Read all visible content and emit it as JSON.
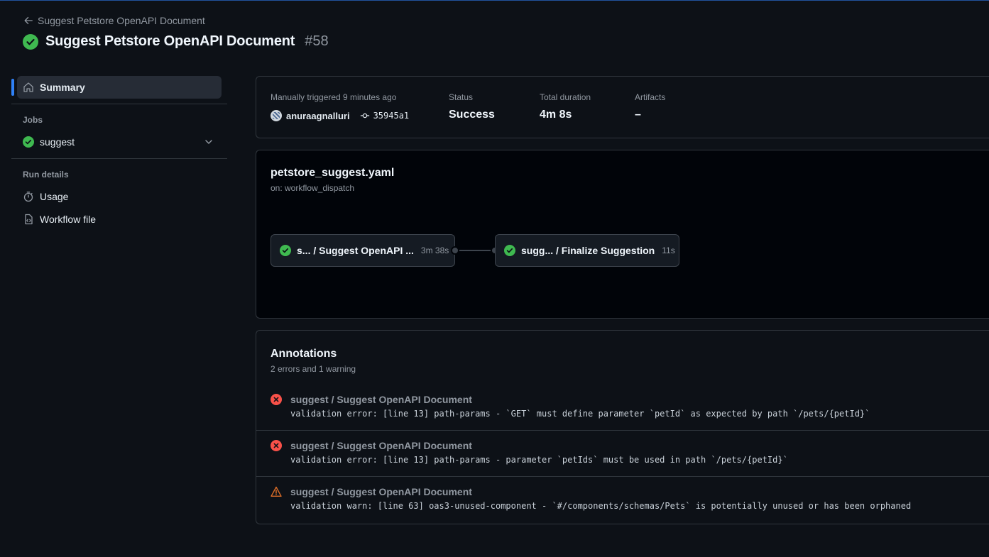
{
  "header": {
    "back_label": "Suggest Petstore OpenAPI Document",
    "title": "Suggest Petstore OpenAPI Document",
    "run_number": "#58"
  },
  "sidebar": {
    "summary_label": "Summary",
    "jobs_heading": "Jobs",
    "job_label": "suggest",
    "run_details_heading": "Run details",
    "usage_label": "Usage",
    "workflow_file_label": "Workflow file"
  },
  "summary": {
    "trigger_label": "Manually triggered 9 minutes ago",
    "actor": "anuraagnalluri",
    "commit": "35945a1",
    "status_label": "Status",
    "status_value": "Success",
    "duration_label": "Total duration",
    "duration_value": "4m 8s",
    "artifacts_label": "Artifacts",
    "artifacts_value": "–"
  },
  "workflow": {
    "file": "petstore_suggest.yaml",
    "trigger": "on: workflow_dispatch",
    "jobs": [
      {
        "name": "s... / Suggest OpenAPI ...",
        "duration": "3m 38s"
      },
      {
        "name": "sugg...  / Finalize Suggestion",
        "duration": "11s"
      }
    ]
  },
  "annotations": {
    "title": "Annotations",
    "subtitle": "2 errors and 1 warning",
    "items": [
      {
        "type": "error",
        "title": "suggest / Suggest OpenAPI Document",
        "message": "validation error: [line 13] path-params - `GET` must define parameter `petId` as expected by path `/pets/{petId}`"
      },
      {
        "type": "error",
        "title": "suggest / Suggest OpenAPI Document",
        "message": "validation error: [line 13] path-params - parameter `petIds` must be used in path `/pets/{petId}`"
      },
      {
        "type": "warning",
        "title": "suggest / Suggest OpenAPI Document",
        "message": "validation warn: [line 63] oas3-unused-component - `#/components/schemas/Pets` is potentially unused or has been orphaned"
      }
    ]
  },
  "colors": {
    "success": "#3fb950",
    "error": "#f85149",
    "warning": "#db6d28",
    "accent": "#2f81f7"
  }
}
